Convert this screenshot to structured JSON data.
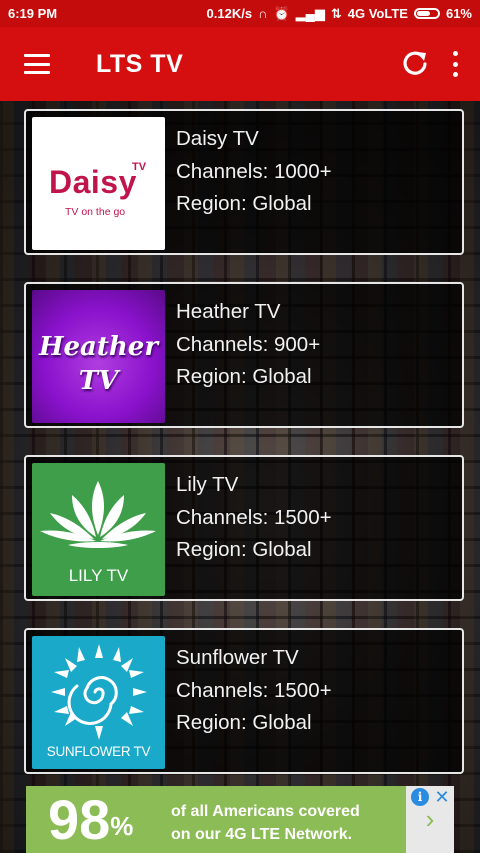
{
  "status_bar": {
    "time": "6:19 PM",
    "speed": "0.12K/s",
    "network": "4G VoLTE",
    "battery": "61%"
  },
  "app_bar": {
    "title": "LTS TV"
  },
  "channels": [
    {
      "name": "Daisy TV",
      "channels": "Channels: 1000+",
      "region": "Region: Global",
      "logo_text": "Daisy",
      "logo_tv": "TV",
      "logo_sub": "TV on the go"
    },
    {
      "name": "Heather TV",
      "channels": "Channels: 900+",
      "region": "Region: Global",
      "logo_text": "Heather",
      "logo_tv": "TV"
    },
    {
      "name": "Lily TV",
      "channels": "Channels: 1500+",
      "region": "Region: Global",
      "logo_text": "LILY TV"
    },
    {
      "name": "Sunflower TV",
      "channels": "Channels: 1500+",
      "region": "Region: Global",
      "logo_text": "SUNFLOWER TV"
    }
  ],
  "ad": {
    "percent": "98",
    "percent_sign": "%",
    "line1": "of all Americans covered",
    "line2": "on our 4G LTE Network.",
    "arrow": "›",
    "info": "i",
    "close": "✕"
  },
  "colors": {
    "app_bar": "#d50f0f",
    "status_bar": "#c40c0c",
    "ad_green": "#8cbc55"
  }
}
